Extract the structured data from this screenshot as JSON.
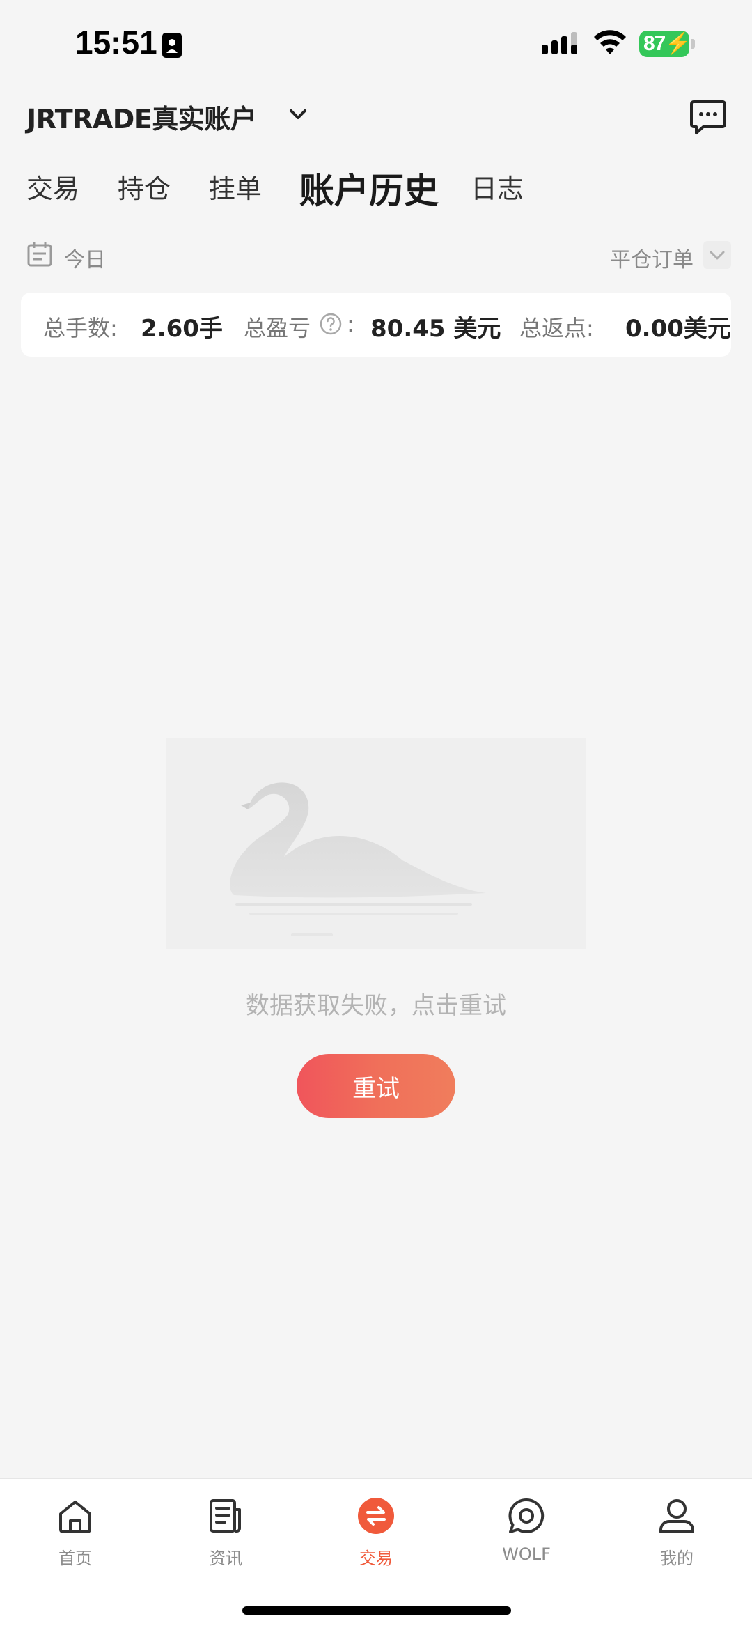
{
  "status_bar": {
    "time": "15:51",
    "battery": "87",
    "icons": [
      "contact-card-icon",
      "cellular-signal-icon",
      "wifi-icon",
      "battery-charging-icon"
    ]
  },
  "header": {
    "account_name": "JRTRADE真实账户",
    "account_menu_icon": "chevron-down-icon",
    "message_icon": "chat-bubble-icon"
  },
  "tabs": [
    {
      "label": "交易",
      "active": false
    },
    {
      "label": "持仓",
      "active": false
    },
    {
      "label": "挂单",
      "active": false
    },
    {
      "label": "账户历史",
      "active": true
    },
    {
      "label": "日志",
      "active": false
    }
  ],
  "filters": {
    "date_range": "今日",
    "order_type": "平仓订单"
  },
  "summary": {
    "lots_label": "总手数:",
    "lots_value": "2.60手",
    "pnl_label": "总盈亏",
    "pnl_colon": ":",
    "pnl_value": "80.45 美元",
    "rebate_label": "总返点:",
    "rebate_value": "0.00美元"
  },
  "empty_state": {
    "illustration": "swan-placeholder-image",
    "message": "数据获取失败，点击重试",
    "retry_label": "重试"
  },
  "bottom_nav": [
    {
      "label": "首页",
      "icon": "home-icon",
      "active": false
    },
    {
      "label": "资讯",
      "icon": "news-icon",
      "active": false
    },
    {
      "label": "交易",
      "icon": "exchange-icon",
      "active": true
    },
    {
      "label": "WOLF",
      "icon": "chat-icon",
      "active": false
    },
    {
      "label": "我的",
      "icon": "user-icon",
      "active": false
    }
  ],
  "colors": {
    "accent": "#f05a3b",
    "background": "#f5f5f5",
    "battery": "#34c759",
    "retry_gradient_start": "#f0555b",
    "retry_gradient_end": "#f07d5c"
  }
}
